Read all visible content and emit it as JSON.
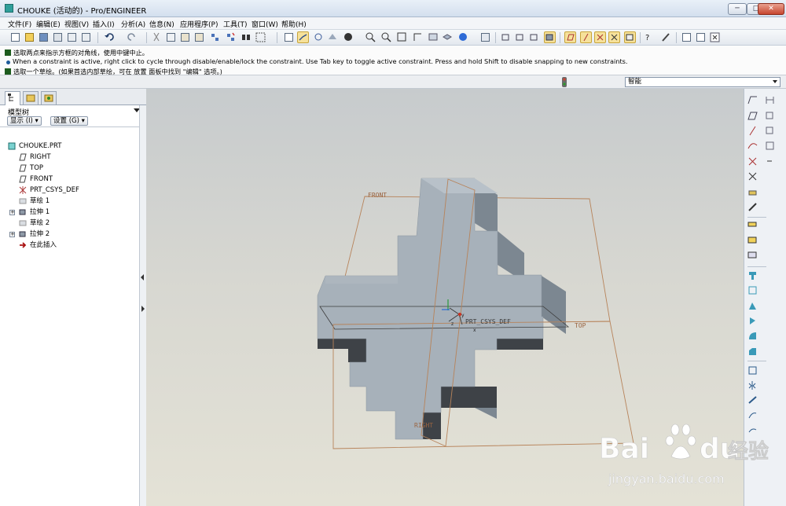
{
  "window": {
    "title": "CHOUKE (活动的) - Pro/ENGINEER",
    "controls": {
      "minimize": "─",
      "maximize": "□",
      "close": "✕"
    }
  },
  "menu": [
    "文件(F)",
    "编辑(E)",
    "视图(V)",
    "插入(I)",
    "分析(A)",
    "信息(N)",
    "应用程序(P)",
    "工具(T)",
    "窗口(W)",
    "帮助(H)"
  ],
  "messages": [
    "选取两点来指示方框的对角线，使用中键中止。",
    "When a constraint is active, right click to cycle through disable/enable/lock the constraint. Use Tab key to toggle active constraint. Press and hold Shift to disable snapping to new constraints.",
    "选取一个草绘。(如果首选内部草绘，可在 放置 面板中找到 \"编辑\" 选项。)"
  ],
  "filter": {
    "selected": "智能"
  },
  "navigator": {
    "title": "模型树",
    "show_label": "显示 (I) ▾",
    "settings_label": "设置 (G) ▾",
    "tree": [
      {
        "label": "CHOUKE.PRT",
        "icon": "part-icon",
        "level": 0,
        "expandable": false
      },
      {
        "label": "RIGHT",
        "icon": "datum-plane-icon",
        "level": 1,
        "expandable": false
      },
      {
        "label": "TOP",
        "icon": "datum-plane-icon",
        "level": 1,
        "expandable": false
      },
      {
        "label": "FRONT",
        "icon": "datum-plane-icon",
        "level": 1,
        "expandable": false
      },
      {
        "label": "PRT_CSYS_DEF",
        "icon": "csys-icon",
        "level": 1,
        "expandable": false
      },
      {
        "label": "草绘 1",
        "icon": "sketch-icon",
        "level": 1,
        "expandable": false
      },
      {
        "label": "拉伸 1",
        "icon": "extrude-icon",
        "level": 1,
        "expandable": true
      },
      {
        "label": "草绘 2",
        "icon": "sketch-icon",
        "level": 1,
        "expandable": false
      },
      {
        "label": "拉伸 2",
        "icon": "extrude-icon",
        "level": 1,
        "expandable": true
      },
      {
        "label": "在此插入",
        "icon": "insert-here-icon",
        "level": 1,
        "expandable": false
      }
    ]
  },
  "viewport": {
    "datum_labels": {
      "front": "FRONT",
      "top": "TOP",
      "right": "RIGHT",
      "csys": "PRT_CSYS_DEF"
    },
    "axis_labels": {
      "x": "x",
      "y": "y",
      "z": "z"
    },
    "colors": {
      "plane": "#b7835a",
      "model_light": "#a7b1ba",
      "model_dark": "#3e4247",
      "model_side": "#7c8791"
    }
  },
  "watermark": {
    "brand": "Bai",
    "brand2": "du",
    "cn": "经验",
    "url": "jingyan.baidu.com"
  }
}
